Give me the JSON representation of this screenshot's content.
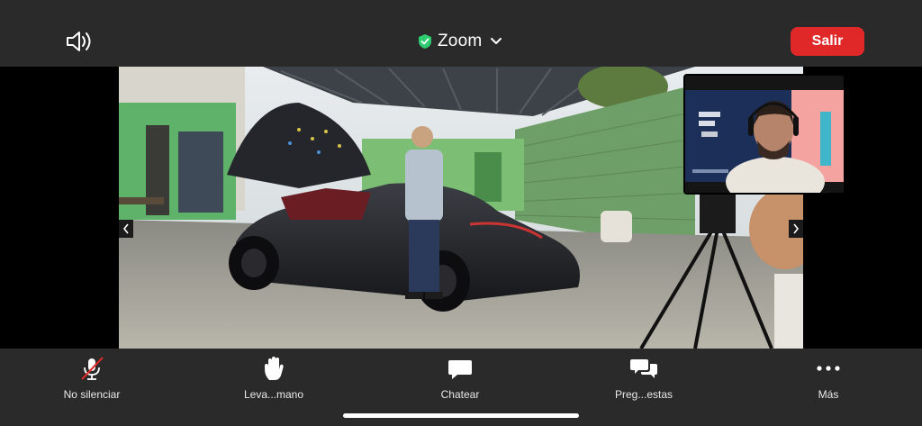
{
  "header": {
    "title": "Zoom",
    "leave_label": "Salir",
    "speaker_icon": "speaker-icon",
    "secure_icon": "shield-check-icon",
    "leave_color": "#e02828",
    "secure_color": "#2ecc71"
  },
  "video": {
    "main_description_icon": "video-feed",
    "pip_description_icon": "video-thumbnail"
  },
  "toolbar": {
    "items": [
      {
        "label": "No silenciar",
        "icon": "mic-muted-icon"
      },
      {
        "label": "Leva...mano",
        "icon": "raise-hand-icon"
      },
      {
        "label": "Chatear",
        "icon": "chat-icon"
      },
      {
        "label": "Preg...estas",
        "icon": "qa-icon"
      },
      {
        "label": "Más",
        "icon": "more-icon"
      }
    ],
    "muted_color": "#e02828"
  }
}
